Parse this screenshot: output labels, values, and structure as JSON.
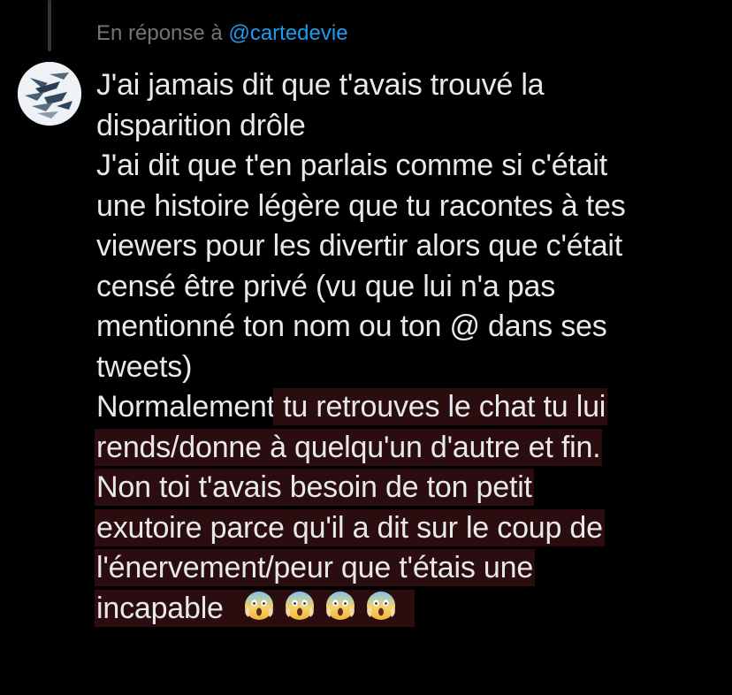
{
  "reply": {
    "prefix": "En réponse à",
    "handle": "@cartedevie"
  },
  "tweet": {
    "lines": [
      "J'ai jamais dit que t'avais trouvé la",
      "disparition drôle",
      "J'ai dit que t'en parlais comme si c'était",
      "une histoire légère que tu racontes à tes",
      "viewers pour les divertir alors que c'était",
      "censé être privé (vu que lui n'a pas",
      "mentionné ton nom ou ton @ dans ses",
      "tweets)"
    ],
    "highlighted_block": {
      "first_line_plain": "Normalement",
      "first_line_highlighted": " tu retrouves le chat tu lui",
      "lines": [
        "rends/donne à quelqu'un d'autre et fin.",
        "Non toi t'avais besoin de ton petit",
        "exutoire parce qu'il a dit sur le coup de",
        "l'énervement/peur que t'étais une",
        "incapable"
      ]
    },
    "emojis": [
      "face-screaming-in-fear-icon",
      "face-screaming-in-fear-icon",
      "face-screaming-in-fear-icon",
      "face-screaming-in-fear-icon"
    ]
  },
  "colors": {
    "background": "#000000",
    "text": "#e7e9ea",
    "muted": "#71767b",
    "link": "#1d9bf0",
    "highlight": "#2b0d0f"
  }
}
